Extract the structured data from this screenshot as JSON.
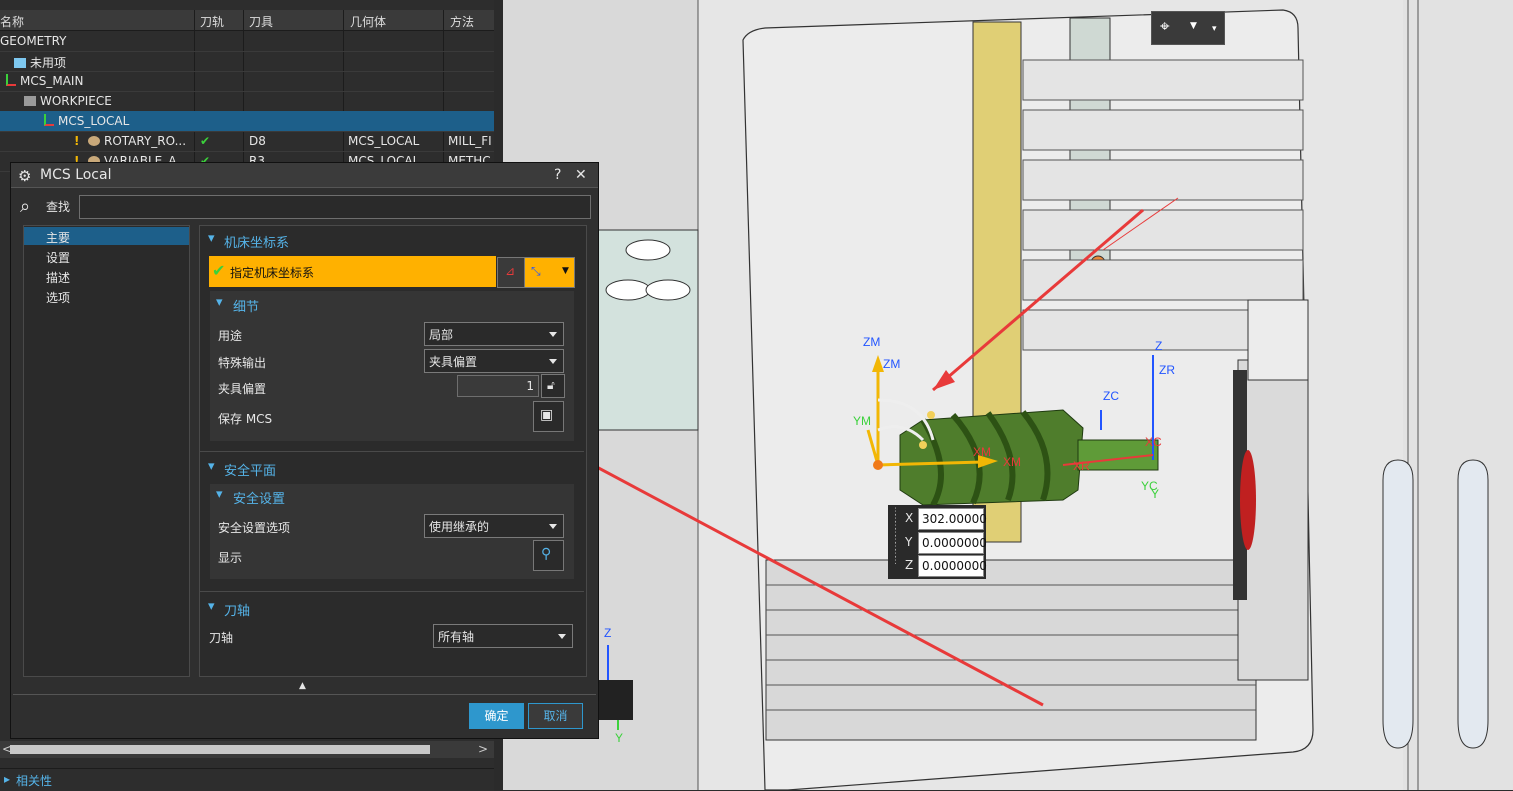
{
  "navigator": {
    "columns": [
      "名称",
      "刀轨",
      "刀具",
      "几何体",
      "方法"
    ],
    "rows": [
      {
        "name": "GEOMETRY",
        "path": "",
        "tool": "",
        "geometry": "",
        "method": ""
      },
      {
        "name": "未用项",
        "path": "",
        "tool": "",
        "geometry": "",
        "method": ""
      },
      {
        "name": "MCS_MAIN",
        "path": "",
        "tool": "",
        "geometry": "",
        "method": ""
      },
      {
        "name": "WORKPIECE",
        "path": "",
        "tool": "",
        "geometry": "",
        "method": ""
      },
      {
        "name": "MCS_LOCAL",
        "path": "",
        "tool": "",
        "geometry": "",
        "method": ""
      },
      {
        "name": "ROTARY_RO...",
        "path": "✔",
        "tool": "D8",
        "geometry": "MCS_LOCAL",
        "method": "MILL_FI"
      },
      {
        "name": "VARIABLE_A...",
        "path": "✔",
        "tool": "R3",
        "geometry": "MCS_LOCAL",
        "method": "METHC"
      }
    ],
    "relations_label": "相关性"
  },
  "dialog": {
    "title": "MCS Local",
    "help": "?",
    "close": "✕",
    "find_label": "查找",
    "find_value": "",
    "tree": [
      "主要",
      "设置",
      "描述",
      "选项"
    ],
    "machine_cs": {
      "header": "机床坐标系",
      "specify": "指定机床坐标系",
      "details_header": "细节",
      "purpose_label": "用途",
      "purpose_value": "局部",
      "special_output_label": "特殊输出",
      "special_output_value": "夹具偏置",
      "fixture_offset_label": "夹具偏置",
      "fixture_offset_value": "1",
      "save_mcs_label": "保存 MCS"
    },
    "clearance": {
      "header": "安全平面",
      "settings_header": "安全设置",
      "option_label": "安全设置选项",
      "option_value": "使用继承的",
      "display_label": "显示"
    },
    "tool_axis": {
      "header": "刀轴",
      "label": "刀轴",
      "value": "所有轴"
    },
    "ok": "确定",
    "cancel": "取消"
  },
  "viewport": {
    "coords": {
      "x_label": "X",
      "x": "302.00000",
      "y_label": "Y",
      "y": "0.0000000",
      "z_label": "Z",
      "z": "0.0000000"
    },
    "axis_labels": [
      "ZM",
      "ZM",
      "YM",
      "XM",
      "XM",
      "ZC",
      "Z",
      "ZR",
      "XC",
      "XR",
      "YC",
      "Y",
      "Z",
      "Y"
    ]
  },
  "colors": {
    "accent": "#ffb100",
    "selected": "#1d5f8a",
    "section": "#55b3e8",
    "ok": "#2e97cd",
    "check": "#3bd13b",
    "arrow": "#e83a3a"
  }
}
